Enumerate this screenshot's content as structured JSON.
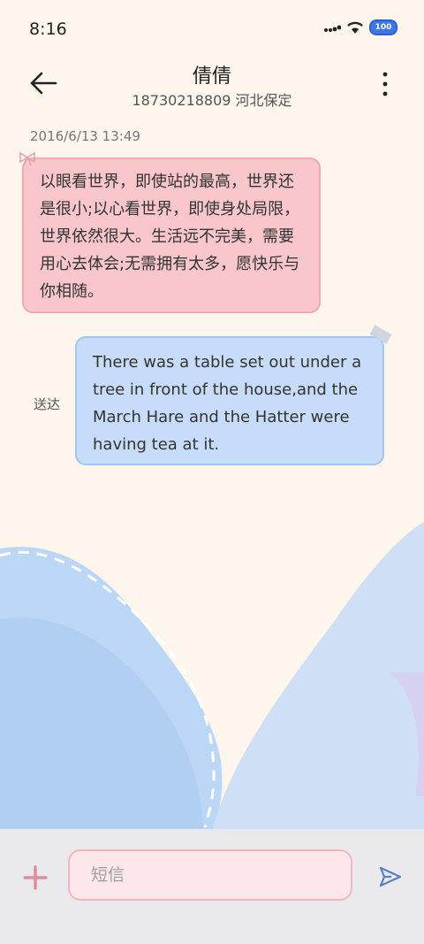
{
  "status_bar": {
    "time": "8:16",
    "battery": "100"
  },
  "header": {
    "contact_name": "倩倩",
    "contact_subtitle": "18730218809 河北保定"
  },
  "conversation": {
    "timestamp": "2016/6/13 13:49",
    "incoming_message": "以眼看世界，即使站的最高，世界还是很小;以心看世界，即使身处局限，世界依然很大。生活远不完美，需要用心去体会;无需拥有太多，愿快乐与你相随。",
    "outgoing_message": "There was a table set out under a tree in front of the house,and the March Hare and the Hatter were having tea at it.",
    "delivery_status": "送达"
  },
  "composer": {
    "placeholder": "短信"
  },
  "colors": {
    "incoming_bubble": "#f9c6cb",
    "outgoing_bubble": "#c7dcfa",
    "background": "#fcf6ec",
    "accent_blue": "#3f76e6",
    "plus_pink": "#e08a9a"
  }
}
